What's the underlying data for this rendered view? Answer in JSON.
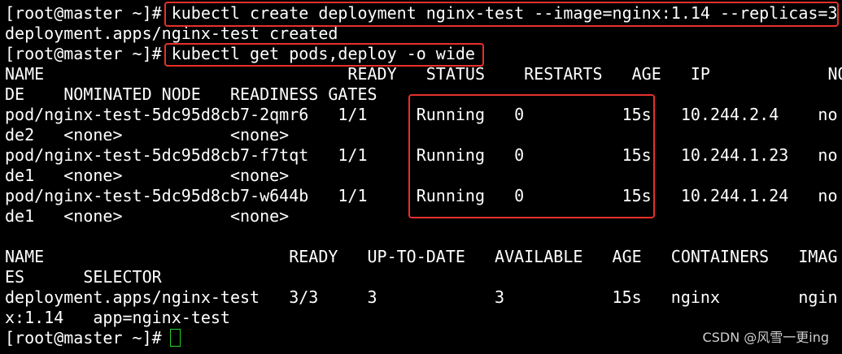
{
  "terminal": {
    "prompt": "[root@master ~]# ",
    "command1": "kubectl create deployment nginx-test --image=nginx:1.14 --replicas=3",
    "output1": "deployment.apps/nginx-test created",
    "command2": "kubectl get pods,deploy -o wide",
    "pods_header_1": "NAME                               READY   STATUS    RESTARTS   AGE   IP            NO",
    "pods_header_2": "DE    NOMINATED NODE   READINESS GATES",
    "pod_rows": [
      {
        "line1": "pod/nginx-test-5dc95d8cb7-2qmr6   1/1     Running   0          15s   10.244.2.4    no",
        "line2": "de2   <none>           <none>"
      },
      {
        "line1": "pod/nginx-test-5dc95d8cb7-f7tqt   1/1     Running   0          15s   10.244.1.23   no",
        "line2": "de1   <none>           <none>"
      },
      {
        "line1": "pod/nginx-test-5dc95d8cb7-w644b   1/1     Running   0          15s   10.244.1.24   no",
        "line2": "de1   <none>           <none>"
      }
    ],
    "deploy_header_1": "NAME                         READY   UP-TO-DATE   AVAILABLE   AGE   CONTAINERS   IMAG",
    "deploy_header_2": "ES      SELECTOR",
    "deploy_row_1": "deployment.apps/nginx-test   3/3     3            3           15s   nginx        ngin",
    "deploy_row_2": "x:1.14   app=nginx-test",
    "final_prompt": "[root@master ~]# "
  },
  "colors": {
    "background": "#000000",
    "text": "#ffffff",
    "highlight_border": "#e8302a",
    "cursor": "#22d322",
    "watermark": "#cfcfcf"
  },
  "watermark": "CSDN @风雪一更ing"
}
